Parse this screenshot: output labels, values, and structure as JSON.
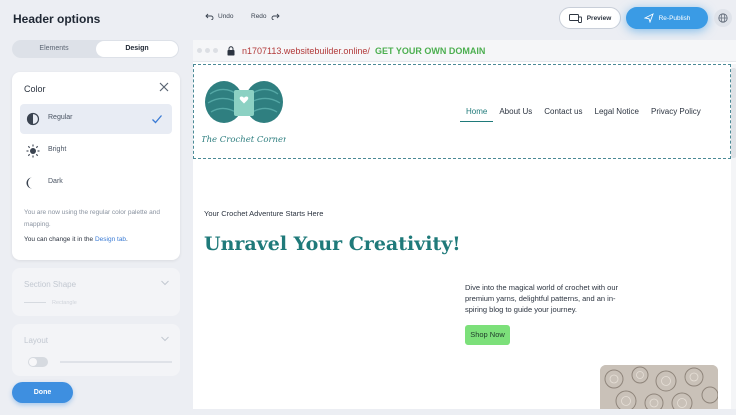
{
  "panel": {
    "title": "Header options",
    "tabs": [
      {
        "label": "Elements"
      },
      {
        "label": "Design"
      }
    ],
    "color_card": {
      "title": "Color",
      "options": [
        {
          "label": "Regular"
        },
        {
          "label": "Bright"
        },
        {
          "label": "Dark"
        }
      ],
      "info_text": "You are now using the regular color palette and mapping.",
      "change_text": "You can change it in the ",
      "change_link": "Design tab",
      "change_suffix": "."
    },
    "section_shape": {
      "title": "Section Shape",
      "sub": "Rectangle"
    },
    "layout": {
      "title": "Layout"
    },
    "done_label": "Done"
  },
  "toolbar": {
    "undo": "Undo",
    "redo": "Redo",
    "preview": "Preview",
    "republish": "Re-Publish"
  },
  "browser": {
    "url": "n1707113.websitebuilder.online/",
    "domain_cta": "GET YOUR OWN DOMAIN"
  },
  "site": {
    "logo_text": "The Crochet Corner",
    "nav": [
      {
        "label": "Home"
      },
      {
        "label": "About Us"
      },
      {
        "label": "Contact us"
      },
      {
        "label": "Legal Notice"
      },
      {
        "label": "Privacy Policy"
      }
    ],
    "tagline": "Your Crochet Adventure Starts Here",
    "headline": "Unravel Your Creativity!",
    "description": "Dive into the magical world of crochet with our premium yarns, delightful patterns, and an in-spiring blog to guide your journey.",
    "shop_label": "Shop Now"
  },
  "colors": {
    "accent": "#3a9be5",
    "brand_teal": "#1f7a7a",
    "shop_button": "#7ce07a",
    "url_red": "#b23a3a",
    "domain_green": "#4caf50"
  }
}
